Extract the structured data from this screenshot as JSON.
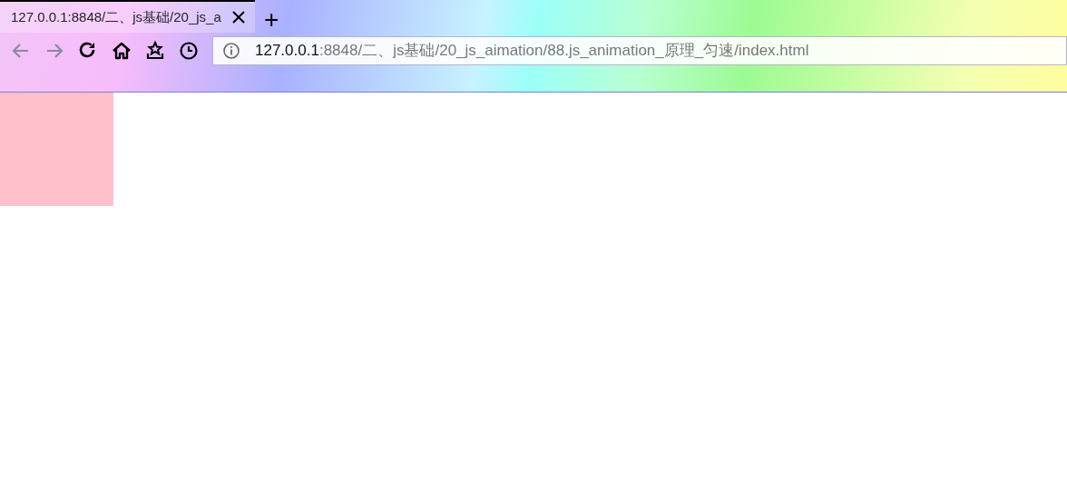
{
  "tabs": [
    {
      "title": "127.0.0.1:8848/二、js基础/20_js_a",
      "selected": true
    }
  ],
  "new_tab": "+",
  "nav_buttons": [
    {
      "kind": "back",
      "disabled": true
    },
    {
      "kind": "forward",
      "disabled": true
    },
    {
      "kind": "reload",
      "disabled": false
    },
    {
      "kind": "home",
      "disabled": false
    },
    {
      "kind": "bookmarks",
      "disabled": false
    },
    {
      "kind": "history",
      "disabled": false
    }
  ],
  "address_bar": {
    "host": "127.0.0.1",
    "path": ":8848/二、js基础/20_js_aimation/88.js_animation_原理_匀速/index.html"
  },
  "page": {
    "animated_box": {
      "color": "#ffc0cb"
    }
  }
}
